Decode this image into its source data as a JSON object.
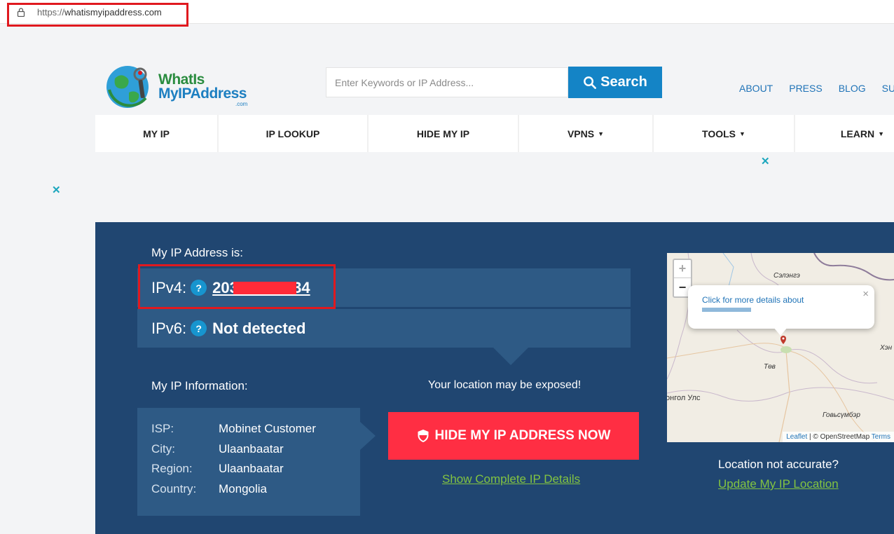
{
  "browser": {
    "url_protocol": "https://",
    "url_host": "whatismyipaddress.com"
  },
  "logo": {
    "line1": "WhatIs",
    "line2": "MyIPAddress",
    "line3": ".com"
  },
  "search": {
    "placeholder": "Enter Keywords or IP Address...",
    "button_label": "Search"
  },
  "toplinks": [
    "ABOUT",
    "PRESS",
    "BLOG",
    "SUP"
  ],
  "nav": {
    "items": [
      {
        "label": "MY IP",
        "dropdown": false
      },
      {
        "label": "IP LOOKUP",
        "dropdown": false
      },
      {
        "label": "HIDE MY IP",
        "dropdown": false
      },
      {
        "label": "VPNS",
        "dropdown": true
      },
      {
        "label": "TOOLS",
        "dropdown": true
      },
      {
        "label": "LEARN",
        "dropdown": true
      }
    ],
    "caret": "▼"
  },
  "ad": {
    "close_glyph": "✕"
  },
  "main": {
    "my_ip_label": "My IP Address is:",
    "ipv4": {
      "label": "IPv4:",
      "value": "203.34.112.34",
      "help": "?"
    },
    "ipv6": {
      "label": "IPv6:",
      "value": "Not detected",
      "help": "?"
    },
    "info_label": "My IP Information:",
    "info": [
      {
        "key": "ISP:",
        "value": "Mobinet Customer"
      },
      {
        "key": "City:",
        "value": "Ulaanbaatar"
      },
      {
        "key": "Region:",
        "value": "Ulaanbaatar"
      },
      {
        "key": "Country:",
        "value": "Mongolia"
      }
    ],
    "exposed_text": "Your location may be exposed!",
    "hide_button": "HIDE MY IP ADDRESS NOW",
    "details_link": "Show Complete IP Details",
    "location_question": "Location not accurate?",
    "update_link": "Update My IP Location"
  },
  "map": {
    "zoom_in": "+",
    "zoom_out": "−",
    "popup_text": "Click for more details about",
    "popup_close": "×",
    "labels": [
      "Сэлэнгэ",
      "Хэн",
      "Төв",
      "онгол Улс",
      "Говьсүмбэр"
    ],
    "attribution": {
      "leaflet": "Leaflet",
      "sep": " | © OpenStreetMap ",
      "terms": "Terms"
    }
  },
  "colors": {
    "panel": "#204671",
    "panel_light": "#2e5a85",
    "accent_blue": "#1484c6",
    "hide_red": "#ff2e43",
    "link_green": "#82c341",
    "highlight_red": "#e0191f"
  }
}
